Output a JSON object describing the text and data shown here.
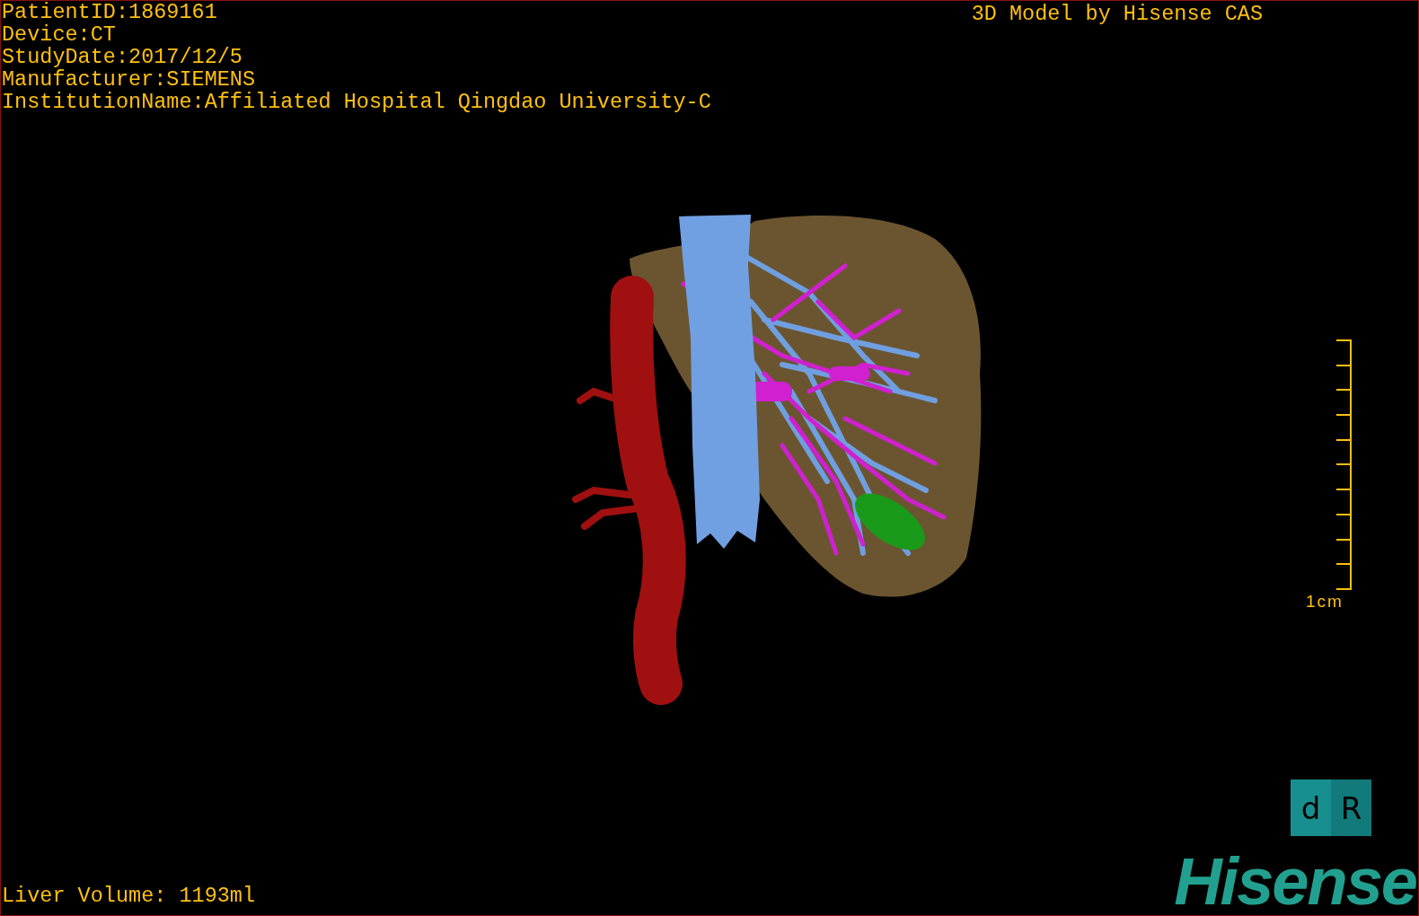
{
  "patient_info": [
    "PatientID:1869161",
    "Device:CT",
    "StudyDate:2017/12/5",
    "Manufacturer:SIEMENS",
    "InstitutionName:Affiliated Hospital Qingdao University-C"
  ],
  "title": "3D Model by Hisense CAS",
  "scale_bar": {
    "label": "1cm"
  },
  "orientation_cube": {
    "faces": [
      "d",
      "R"
    ]
  },
  "logo": "Hisense",
  "liver_volume": "Liver Volume: 1193ml"
}
